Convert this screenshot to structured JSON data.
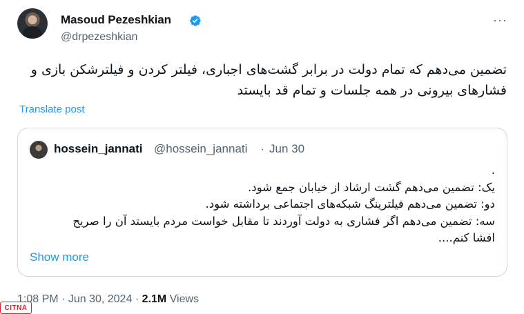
{
  "author": {
    "name": "Masoud Pezeshkian",
    "handle": "@drpezeshkian",
    "verified": true
  },
  "tweet": {
    "text": "تضمین می‌دهم که تمام دولت در برابر گشت‌های اجباری، فیلتر کردن و فیلترشکن بازی و فشارهای بیرونی در همه جلسات و تمام قد بایستد",
    "translate_label": "Translate post"
  },
  "quoted": {
    "name": "hossein_jannati",
    "handle": "@hossein_jannati",
    "separator": "·",
    "date": "Jun 30",
    "lines": [
      ".",
      "یک: تضمین می‌دهم گشت ارشاد از خیابان جمع شود.",
      "دو: تضمین می‌دهم فیلترینگ شبکه‌های اجتماعی برداشته شود.",
      "سه: تضمین می‌دهم اگر فشاری به دولت آوردند تا مقابل خواست مردم بایستد آن را صریح",
      "افشا کنم...."
    ],
    "show_more": "Show more"
  },
  "meta": {
    "time": "1:08 PM",
    "dot1": "·",
    "date": "Jun 30, 2024",
    "dot2": "·",
    "views_count": "2.1M",
    "views_label": "Views"
  },
  "watermark": "CITNA",
  "colors": {
    "accent": "#1d9bf0",
    "secondary_text": "#536471",
    "border": "#cfd9de",
    "watermark": "#d4202a"
  },
  "icons": [
    "verified-badge-icon",
    "more-options-icon"
  ]
}
